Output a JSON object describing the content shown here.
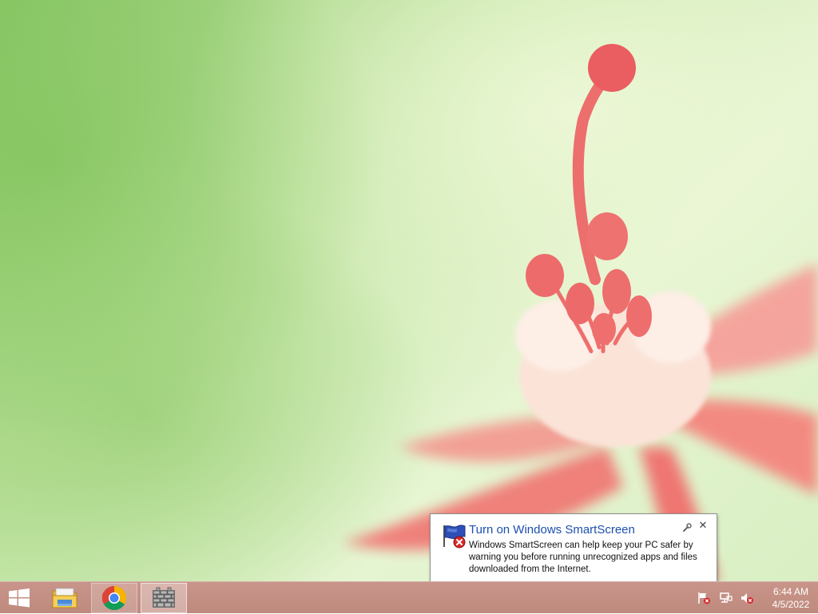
{
  "taskbar": {
    "buttons": [
      {
        "name": "start",
        "icon": "windows-logo-icon"
      },
      {
        "name": "file-explorer",
        "icon": "folder-icon"
      },
      {
        "name": "google-chrome",
        "icon": "chrome-icon"
      },
      {
        "name": "windows-firewall",
        "icon": "firewall-icon"
      }
    ],
    "tray": {
      "icons": [
        "action-center-flag-icon",
        "network-icon",
        "volume-muted-icon"
      ],
      "time": "6:44 AM",
      "date": "4/5/2022"
    }
  },
  "notification": {
    "title": "Turn on Windows SmartScreen",
    "body": "Windows SmartScreen can help keep your PC safer by warning you before running unrecognized apps and files downloaded from the Internet.",
    "icon": "action-center-flag-error-icon",
    "title_color": "#1c4fb0"
  },
  "colors": {
    "taskbar": "#c3907f",
    "desktop_green": "#bfe3a0",
    "flower_pink": "#f47e7e"
  }
}
